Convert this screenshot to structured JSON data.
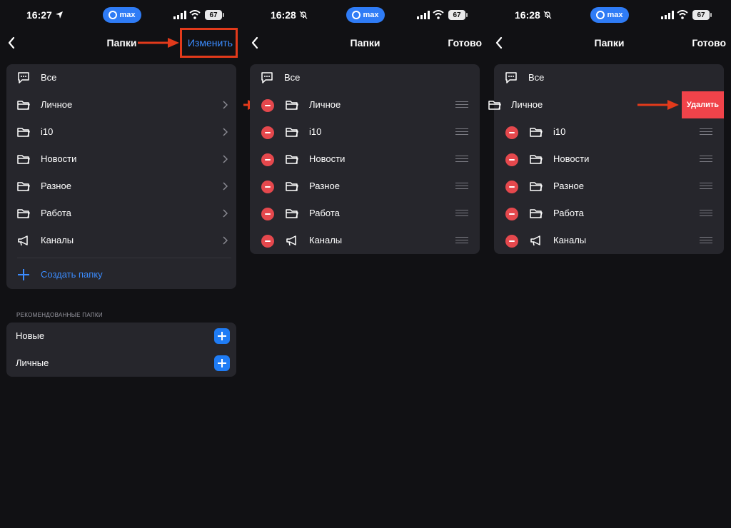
{
  "colors": {
    "accent": "#3b8cff",
    "delete": "#f0434a",
    "annotation": "#e23a1b",
    "card": "#26262c",
    "background": "#111114"
  },
  "panels": [
    {
      "status": {
        "time": "16:27",
        "status_icon": "location-arrow-icon",
        "app_badge": "max",
        "battery": "67"
      },
      "nav": {
        "back_icon": "chevron-left-icon",
        "title": "Папки",
        "action": "Изменить"
      },
      "folders": [
        {
          "label": "Все",
          "icon": "chat-bubble-icon"
        },
        {
          "label": "Личное",
          "icon": "folder-icon"
        },
        {
          "label": "i10",
          "icon": "folder-icon"
        },
        {
          "label": "Новости",
          "icon": "folder-icon"
        },
        {
          "label": "Разное",
          "icon": "folder-icon"
        },
        {
          "label": "Работа",
          "icon": "folder-icon"
        },
        {
          "label": "Каналы",
          "icon": "megaphone-icon"
        }
      ],
      "create_folder": "Создать папку",
      "recommended_header": "РЕКОМЕНДОВАННЫЕ ПАПКИ",
      "recommended": [
        {
          "label": "Новые"
        },
        {
          "label": "Личные"
        }
      ]
    },
    {
      "status": {
        "time": "16:28",
        "status_icon": "bell-slash-icon",
        "app_badge": "max",
        "battery": "67"
      },
      "nav": {
        "back_icon": "chevron-left-icon",
        "title": "Папки",
        "action": "Готово"
      },
      "folders": [
        {
          "label": "Все",
          "icon": "chat-bubble-icon"
        },
        {
          "label": "Личное",
          "icon": "folder-icon"
        },
        {
          "label": "i10",
          "icon": "folder-icon"
        },
        {
          "label": "Новости",
          "icon": "folder-icon"
        },
        {
          "label": "Разное",
          "icon": "folder-icon"
        },
        {
          "label": "Работа",
          "icon": "folder-icon"
        },
        {
          "label": "Каналы",
          "icon": "megaphone-icon"
        }
      ]
    },
    {
      "status": {
        "time": "16:28",
        "status_icon": "bell-slash-icon",
        "app_badge": "max",
        "battery": "67"
      },
      "nav": {
        "back_icon": "chevron-left-icon",
        "title": "Папки",
        "action": "Готово"
      },
      "folders": [
        {
          "label": "Все",
          "icon": "chat-bubble-icon"
        },
        {
          "label": "Личное",
          "icon": "folder-icon"
        },
        {
          "label": "i10",
          "icon": "folder-icon"
        },
        {
          "label": "Новости",
          "icon": "folder-icon"
        },
        {
          "label": "Разное",
          "icon": "folder-icon"
        },
        {
          "label": "Работа",
          "icon": "folder-icon"
        },
        {
          "label": "Каналы",
          "icon": "megaphone-icon"
        }
      ],
      "delete_label": "Удалить"
    }
  ]
}
